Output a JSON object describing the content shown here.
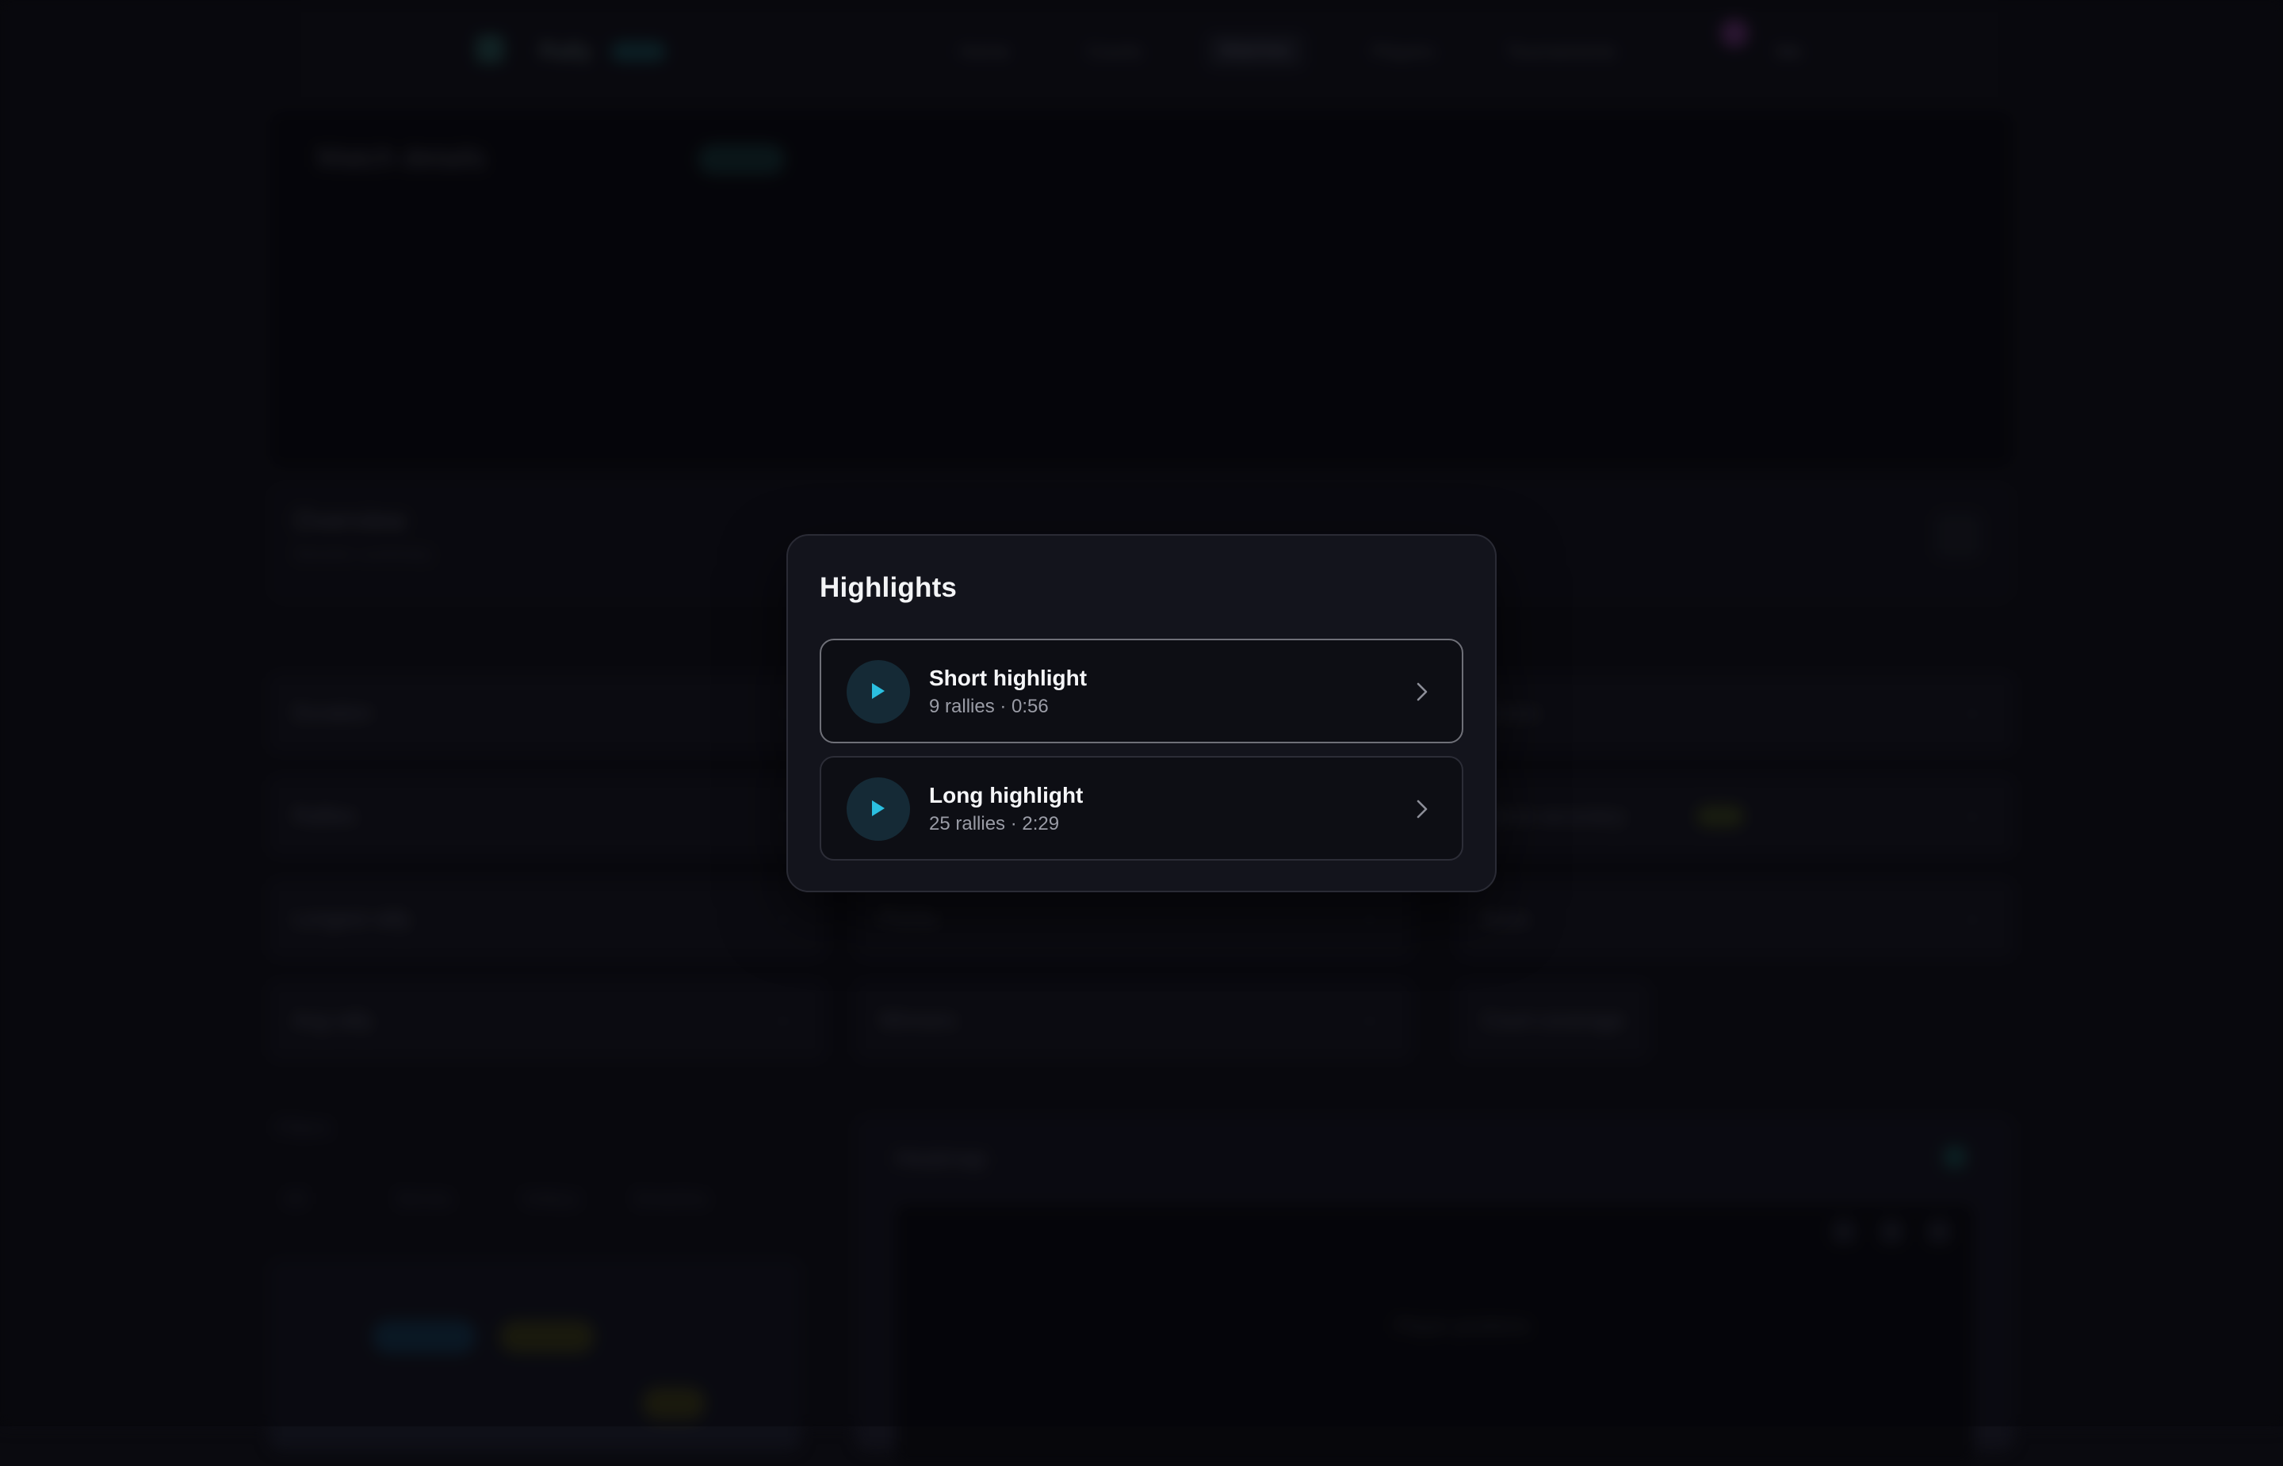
{
  "background": {
    "nav": {
      "logo_text": "Rally",
      "links": [
        "Home",
        "Courts",
        "Matches",
        "Players",
        "Tournaments"
      ],
      "user": "Me"
    },
    "hero": {
      "title": "Match details"
    },
    "section": {
      "title": "Overview",
      "subtitle": "Session summary"
    },
    "stats": [
      {
        "label": "Duration",
        "value": "—"
      },
      {
        "label": "Rallies",
        "value": "—"
      },
      {
        "label": "Longest rally",
        "value": "—"
      },
      {
        "label": "Avg rally",
        "value": "—"
      },
      {
        "label": "Points",
        "value": "—"
      },
      {
        "label": "Winners",
        "value": "—"
      },
      {
        "label": "Errors",
        "value": "—"
      },
      {
        "label": "Serve accuracy",
        "value": "—"
      },
      {
        "label": "Aces",
        "value": "—"
      },
      {
        "label": "Court coverage",
        "value": "—"
      }
    ],
    "filters_label": "Filters",
    "filters": [
      "All",
      "Serves",
      "Volleys",
      "Smashes"
    ],
    "panel_title": "Heatmap",
    "panel_caption": "Player positions"
  },
  "modal": {
    "title": "Highlights",
    "items": [
      {
        "name": "Short highlight",
        "meta": "9 rallies · 0:56",
        "selected": true
      },
      {
        "name": "Long highlight",
        "meta": "25 rallies · 2:29",
        "selected": false
      }
    ]
  },
  "colors": {
    "accent": "#2bbfe0",
    "modal_bg": "#13141c",
    "item_bg": "#0d0e14",
    "page_bg": "#0a0a0f"
  },
  "icons": {
    "play": "play-icon",
    "chevron": "chevron-right-icon"
  }
}
